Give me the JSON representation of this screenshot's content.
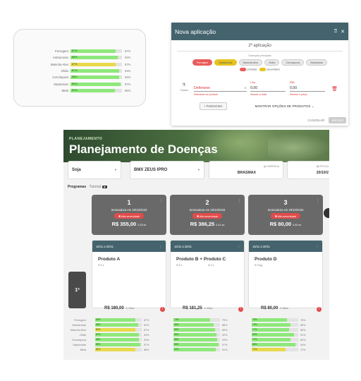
{
  "disease_card": {
    "rows": [
      {
        "label": "Ferrugem",
        "inner": "87%",
        "value": "87%",
        "fill": 0.87,
        "warn": false
      },
      {
        "label": "Antracnose",
        "inner": "86%",
        "value": "92%",
        "fill": 0.92,
        "warn": false
      },
      {
        "label": "Mancha Alvo",
        "inner": "87%",
        "value": "87%",
        "fill": 0.87,
        "warn": true
      },
      {
        "label": "Oídio",
        "inner": "87%",
        "value": "94%",
        "fill": 0.94,
        "warn": false
      },
      {
        "label": "Cercóspora",
        "inner": "86%",
        "value": "94%",
        "fill": 0.94,
        "warn": false
      },
      {
        "label": "Septoriose",
        "inner": "89%",
        "value": "97%",
        "fill": 0.97,
        "warn": false
      },
      {
        "label": "Mela",
        "inner": "81%",
        "value": "86%",
        "fill": 0.86,
        "warn": false
      }
    ]
  },
  "modal": {
    "title": "Nova aplicação",
    "help_icon": "help-circle-icon",
    "close_icon": "close-icon",
    "subtitle": "2ª aplicação",
    "diseases_label": "Doenças principais",
    "chips": [
      {
        "label": "Ferrugem",
        "state": "red"
      },
      {
        "label": "Antracnose",
        "state": "yellow"
      },
      {
        "label": "Mancha Alvo",
        "state": "none"
      },
      {
        "label": "Oídio",
        "state": "none"
      },
      {
        "label": "Cercóspora",
        "state": "none"
      },
      {
        "label": "Septoriose",
        "state": "none"
      }
    ],
    "legend_primary": "primária",
    "legend_secondary": "secundária",
    "doses_label": "Doses",
    "product_top_label": "",
    "product_value": "Defensivo",
    "product_error": "Selecione um produto",
    "dose_top_label": "L/ha",
    "dose_value": "0,00",
    "dose_error": "Informe a dose",
    "price_top_label": "R$/L",
    "price_value": "0,00",
    "price_error": "Informe o preço",
    "fungicide_button": "+ FUNGICIDA",
    "show_options": "MOSTRAR OPÇÕES DE PRODUTOS",
    "cancel": "CANCELAR",
    "save": "SALVAR",
    "colors": {
      "header": "#44636d",
      "primary": "#ea5b5b",
      "secondary": "#e6c320"
    }
  },
  "planning": {
    "kicker": "PLANEJAMENTO",
    "title": "Planejamento de Doenças",
    "crop": "Soja",
    "variety": "BMX ZEUS IPRO",
    "company_label": "EMPRESA",
    "company_value": "BRASMAX",
    "season_label": "ÉPOCA",
    "season_value": "20/10/2",
    "programs_label": "Programas",
    "tutorial_label": "Tutorial",
    "tutorial_badge": "▶",
    "programs": [
      {
        "number": "1",
        "sowing": "Semeadura em 20/10/2023",
        "severity": "Alta severidade",
        "price": "R$ 355,00",
        "price_sub": "2.33 sc"
      },
      {
        "number": "2",
        "sowing": "Semeadura em 20/10/2023",
        "severity": "Alta severidade",
        "price": "R$ 386,25",
        "price_sub": "2.41 sc"
      },
      {
        "number": "3",
        "sowing": "Semeadura em 20/10/2023",
        "severity": "Alta severidade",
        "price": "R$ 80,00",
        "price_sub": "0.50 sc"
      }
    ],
    "stage_label": "1ª",
    "applications": [
      {
        "window": "16/11 a 20/11",
        "product": "Produto A",
        "dose1": "0.9 L",
        "dose2": ""
      },
      {
        "window": "16/11 a 20/11",
        "product": "Produto B + Produto C",
        "dose1": "0.5 L",
        "dose2": "0.4 L"
      },
      {
        "window": "16/11 a 20/11",
        "product": "Produto D",
        "dose1": "0.9 kg",
        "dose2": ""
      }
    ],
    "totals": [
      {
        "value": "R$ 180,00",
        "sub": "1.13sc"
      },
      {
        "value": "R$ 181,25",
        "sub": "1.13sc"
      },
      {
        "value": "R$ 80,00",
        "sub": "0.50sc"
      }
    ],
    "bar_labels": [
      "Ferrugem",
      "Antracnose",
      "Mancha Alvo",
      "Oídio",
      "Cercóspora",
      "Septoriose",
      "Mela"
    ],
    "bar_columns": [
      [
        {
          "inner": "83%",
          "value": "87%",
          "fill": 0.87,
          "warn": false
        },
        {
          "inner": "86%",
          "value": "92%",
          "fill": 0.92,
          "warn": false
        },
        {
          "inner": "83%",
          "value": "87%",
          "fill": 0.87,
          "warn": true
        },
        {
          "inner": "87%",
          "value": "94%",
          "fill": 0.94,
          "warn": false
        },
        {
          "inner": "86%",
          "value": "94%",
          "fill": 0.94,
          "warn": false
        },
        {
          "inner": "89%",
          "value": "97%",
          "fill": 0.97,
          "warn": false
        },
        {
          "inner": "81%",
          "value": "86%",
          "fill": 0.86,
          "warn": true
        }
      ],
      [
        {
          "inner": "74%",
          "value": "79%",
          "fill": 0.79,
          "warn": false
        },
        {
          "inner": "86%",
          "value": "86%",
          "fill": 0.86,
          "warn": false
        },
        {
          "inner": "89%",
          "value": "89%",
          "fill": 0.89,
          "warn": false
        },
        {
          "inner": "86%",
          "value": "92%",
          "fill": 0.92,
          "warn": false
        },
        {
          "inner": "88%",
          "value": "94%",
          "fill": 0.94,
          "warn": false
        },
        {
          "inner": "86%",
          "value": "97%",
          "fill": 0.97,
          "warn": false
        },
        {
          "inner": "90%",
          "value": "91%",
          "fill": 0.91,
          "warn": false
        }
      ],
      [
        {
          "inner": "79%",
          "value": "75%",
          "fill": 0.75,
          "warn": false
        },
        {
          "inner": "79%",
          "value": "83%",
          "fill": 0.83,
          "warn": false
        },
        {
          "inner": "71%",
          "value": "80%",
          "fill": 0.8,
          "warn": false
        },
        {
          "inner": "83%",
          "value": "91%",
          "fill": 0.91,
          "warn": false
        },
        {
          "inner": "77%",
          "value": "84%",
          "fill": 0.84,
          "warn": false
        },
        {
          "inner": "86%",
          "value": "94%",
          "fill": 0.94,
          "warn": false
        },
        {
          "inner": "71%",
          "value": "72%",
          "fill": 0.72,
          "warn": true
        }
      ]
    ]
  }
}
